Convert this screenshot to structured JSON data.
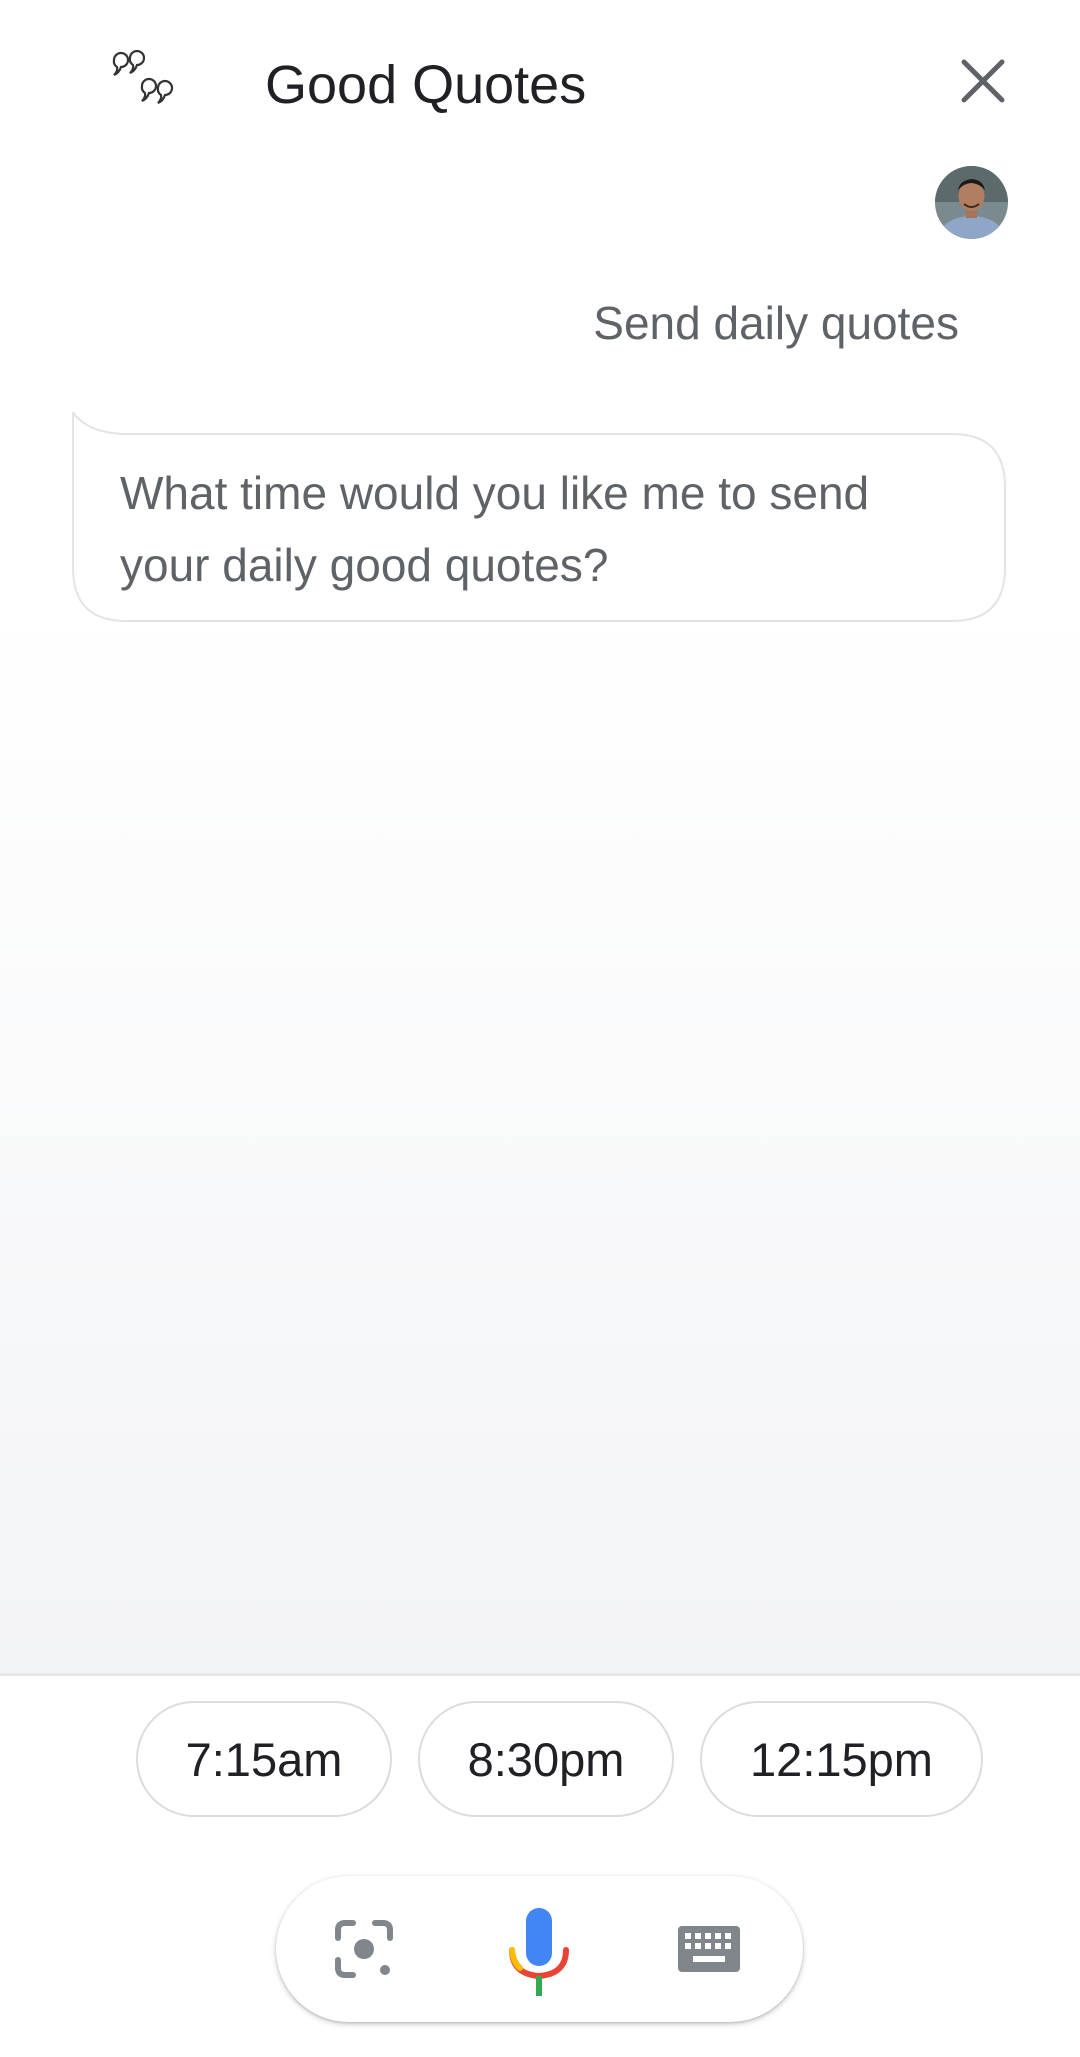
{
  "header": {
    "app_title": "Good Quotes",
    "logo_icon": "quote-marks-icon",
    "close_icon": "close-icon"
  },
  "conversation": {
    "user_message": "Send daily quotes",
    "assistant_message": "What time would you like me to send your daily good quotes?"
  },
  "suggestions": [
    {
      "label": "7:15am"
    },
    {
      "label": "8:30pm"
    },
    {
      "label": "12:15pm"
    }
  ],
  "input_bar": {
    "lens_icon": "lens-icon",
    "mic_icon": "mic-icon",
    "keyboard_icon": "keyboard-icon"
  },
  "colors": {
    "mic_blue": "#4285f4",
    "mic_red": "#ea4335",
    "mic_yellow": "#fbbc04",
    "mic_green": "#34a853",
    "icon_gray": "#80868b"
  }
}
